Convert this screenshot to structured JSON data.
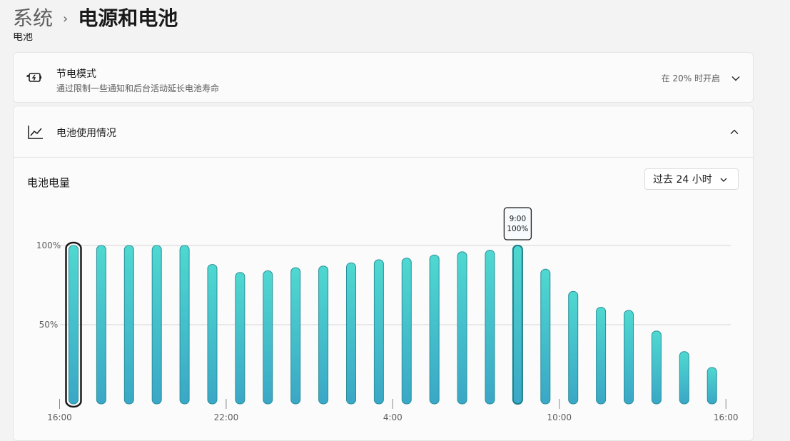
{
  "breadcrumb": {
    "parent": "系统",
    "separator": "›",
    "current": "电源和电池"
  },
  "section_label": "电池",
  "battery_saver": {
    "title": "节电模式",
    "subtitle": "通过限制一些通知和后台活动延长电池寿命",
    "status": "在 20% 时开启",
    "icon": "battery-saver-icon"
  },
  "battery_usage": {
    "title": "电池使用情况",
    "icon": "chart-line-icon",
    "chart_title": "电池电量",
    "range_dropdown": "过去 24 小时"
  },
  "colors": {
    "bar_top": "#4fd8d0",
    "bar_bottom": "#3aa7c6",
    "bar_stroke": "#2a8f9a",
    "gridline": "#d6d6d6"
  },
  "chart_data": {
    "type": "bar",
    "title": "电池电量",
    "y_ticks": [
      "100%",
      "50%"
    ],
    "x_ticks": [
      "16:00",
      "22:00",
      "4:00",
      "10:00",
      "16:00"
    ],
    "ylim": [
      0,
      100
    ],
    "values": [
      100,
      100,
      100,
      100,
      100,
      88,
      83,
      84,
      86,
      87,
      89,
      91,
      92,
      94,
      96,
      97,
      100,
      85,
      71,
      61,
      59,
      46,
      33,
      23
    ],
    "selected_index": 0,
    "tooltip_index": 16,
    "tooltip": {
      "time": "9:00",
      "value": "100%"
    }
  }
}
